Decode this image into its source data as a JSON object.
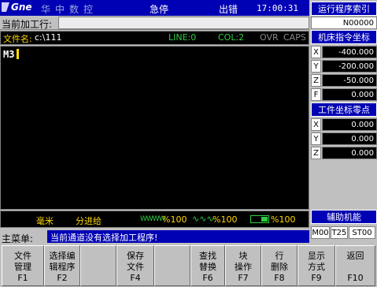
{
  "title": {
    "logo": "Gne",
    "brand": "华中数控",
    "estop": "急停",
    "error": "出错",
    "time": "17:00:31"
  },
  "current_line": {
    "label": "当前加工行:",
    "value": ""
  },
  "file": {
    "label": "文件名:",
    "name": "c:\\111",
    "line": "LINE:0",
    "col": "COL:2",
    "ovr": "OVR",
    "caps": "CAPS"
  },
  "editor": {
    "text": "M3"
  },
  "status": {
    "unit": "毫米",
    "feed_mode": "分进给",
    "feed_icon": "WWWW",
    "feed_override": "%100",
    "spindle_icon": "∿∿∿",
    "spindle_override": "%100",
    "rapid_override": "%100"
  },
  "menu": {
    "label": "主菜单:",
    "message": "当前通道没有选择加工程序!"
  },
  "right_panel": {
    "program_index_title": "运行程序索引",
    "program_number": "N00000",
    "machine_coords_title": "机床指令坐标",
    "machine_coords": [
      {
        "axis": "X",
        "value": "-400.000"
      },
      {
        "axis": "Y",
        "value": "-200.000"
      },
      {
        "axis": "Z",
        "value": "-50.000"
      },
      {
        "axis": "F",
        "value": "0.000"
      }
    ],
    "work_zero_title": "工件坐标零点",
    "work_zero": [
      {
        "axis": "X",
        "value": "0.000"
      },
      {
        "axis": "Y",
        "value": "0.000"
      },
      {
        "axis": "Z",
        "value": "0.000"
      }
    ],
    "aux_title": "辅助机能",
    "aux": {
      "m": "M00",
      "t": "T25",
      "st": "ST00"
    }
  },
  "fkeys": [
    {
      "l1": "文件",
      "l2": "管理",
      "l3": "F1"
    },
    {
      "l1": "选择编",
      "l2": "辑程序",
      "l3": "F2"
    },
    {
      "l1": "",
      "l2": "",
      "l3": ""
    },
    {
      "l1": "保存",
      "l2": "文件",
      "l3": "F4"
    },
    {
      "l1": "",
      "l2": "",
      "l3": ""
    },
    {
      "l1": "查找",
      "l2": "替换",
      "l3": "F6"
    },
    {
      "l1": "块",
      "l2": "操作",
      "l3": "F7"
    },
    {
      "l1": "行",
      "l2": "删除",
      "l3": "F8"
    },
    {
      "l1": "显示",
      "l2": "方式",
      "l3": "F9"
    },
    {
      "l1": "返回",
      "l2": "",
      "l3": "F10"
    }
  ]
}
